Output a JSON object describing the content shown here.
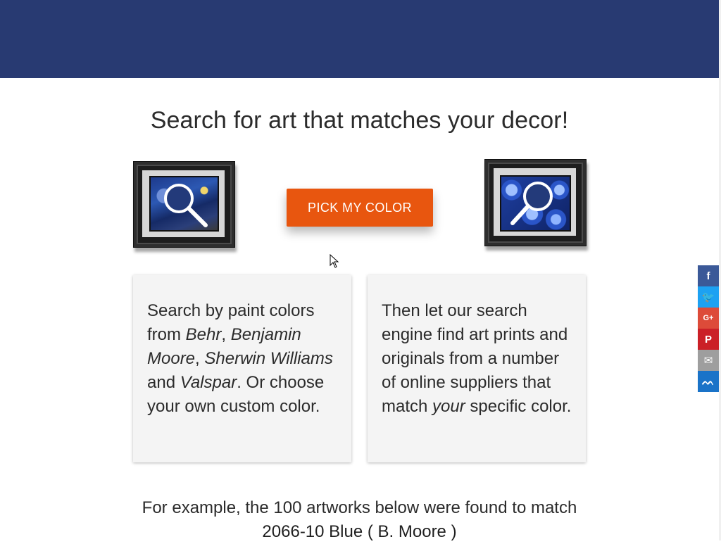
{
  "header": {
    "bar_color": "#283a72"
  },
  "main": {
    "title": "Search for art that matches your decor!",
    "pick_button_label": "PICK MY COLOR",
    "button_color": "#e8560f",
    "cards": [
      {
        "parts": [
          {
            "text": "Search by paint colors from ",
            "italic": false
          },
          {
            "text": "Behr",
            "italic": true
          },
          {
            "text": ", ",
            "italic": false
          },
          {
            "text": "Benjamin Moore",
            "italic": true
          },
          {
            "text": ", ",
            "italic": false
          },
          {
            "text": "Sherwin Williams",
            "italic": true
          },
          {
            "text": " and ",
            "italic": false
          },
          {
            "text": "Valspar",
            "italic": true
          },
          {
            "text": ". Or choose your own custom color.",
            "italic": false
          }
        ]
      },
      {
        "parts": [
          {
            "text": "Then let our search engine find art prints and originals from a number of online suppliers that match ",
            "italic": false
          },
          {
            "text": "your",
            "italic": true
          },
          {
            "text": " specific color.",
            "italic": false
          }
        ]
      }
    ],
    "example_line": "For example, the 100 artworks below were found to match",
    "example_color": "2066-10 Blue ( B. Moore )"
  },
  "share_bar": {
    "buttons": [
      {
        "name": "facebook",
        "icon": "facebook-icon",
        "glyph": "f",
        "color": "#3b5998"
      },
      {
        "name": "twitter",
        "icon": "twitter-icon",
        "glyph": "🐦",
        "color": "#1da1f2"
      },
      {
        "name": "google-plus",
        "icon": "google-plus-icon",
        "glyph": "G+",
        "color": "#dd4b39"
      },
      {
        "name": "pinterest",
        "icon": "pinterest-icon",
        "glyph": "P",
        "color": "#cb2027"
      },
      {
        "name": "email",
        "icon": "email-icon",
        "glyph": "✉",
        "color": "#9e9e9e"
      },
      {
        "name": "sumome",
        "icon": "sumome-icon",
        "glyph": "ᨓ",
        "color": "#1a73c8"
      }
    ]
  }
}
